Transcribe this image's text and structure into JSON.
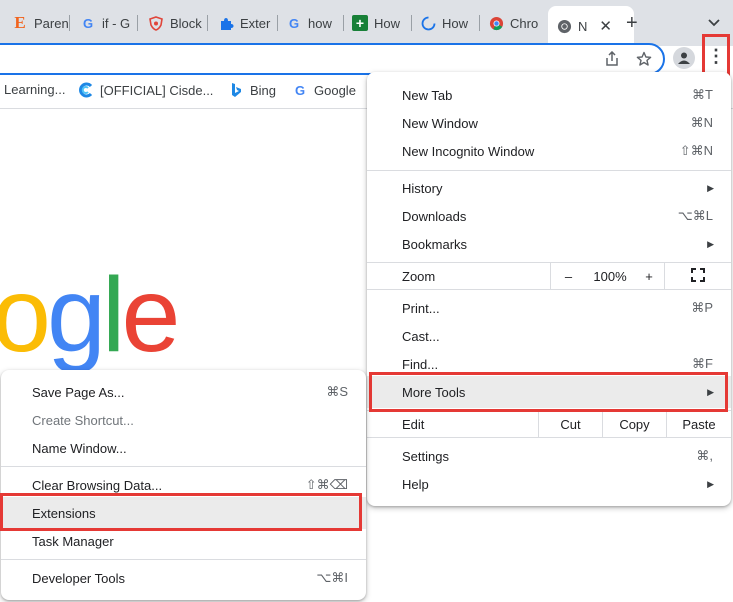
{
  "tabs": [
    {
      "title": "Paren",
      "icon": "etsy-icon"
    },
    {
      "title": "if - G",
      "icon": "google-icon"
    },
    {
      "title": "Block",
      "icon": "shield-icon"
    },
    {
      "title": "Exter",
      "icon": "puzzle-icon"
    },
    {
      "title": "how",
      "icon": "google-icon"
    },
    {
      "title": "How",
      "icon": "plus-icon"
    },
    {
      "title": "How",
      "icon": "loading-icon"
    },
    {
      "title": "Chro",
      "icon": "chrome-icon"
    },
    {
      "title": "N",
      "icon": "chrome-icon"
    }
  ],
  "bookmarks": [
    {
      "label": "Learning...",
      "icon": ""
    },
    {
      "label": "[OFFICIAL] Cisde...",
      "icon": "cisdem-icon"
    },
    {
      "label": "Bing",
      "icon": "bing-icon"
    },
    {
      "label": "Google",
      "icon": "google-icon"
    }
  ],
  "logo_letters": [
    {
      "ch": "o",
      "color": "#fbbc05"
    },
    {
      "ch": "g",
      "color": "#4285f4"
    },
    {
      "ch": "l",
      "color": "#34a853"
    },
    {
      "ch": "e",
      "color": "#ea4335"
    }
  ],
  "main_menu": {
    "new_tab": {
      "label": "New Tab",
      "shortcut": "⌘T"
    },
    "new_window": {
      "label": "New Window",
      "shortcut": "⌘N"
    },
    "new_incognito": {
      "label": "New Incognito Window",
      "shortcut": "⇧⌘N"
    },
    "history": {
      "label": "History"
    },
    "downloads": {
      "label": "Downloads",
      "shortcut": "⌥⌘L"
    },
    "bookmarks": {
      "label": "Bookmarks"
    },
    "zoom": {
      "label": "Zoom",
      "minus": "–",
      "value": "100%",
      "plus": "+"
    },
    "print": {
      "label": "Print...",
      "shortcut": "⌘P"
    },
    "cast": {
      "label": "Cast..."
    },
    "find": {
      "label": "Find...",
      "shortcut": "⌘F"
    },
    "more_tools": {
      "label": "More Tools"
    },
    "edit": {
      "label": "Edit",
      "cut": "Cut",
      "copy": "Copy",
      "paste": "Paste"
    },
    "settings": {
      "label": "Settings",
      "shortcut": "⌘,"
    },
    "help": {
      "label": "Help"
    }
  },
  "sub_menu": {
    "save_page": {
      "label": "Save Page As...",
      "shortcut": "⌘S"
    },
    "create_shortcut": {
      "label": "Create Shortcut..."
    },
    "name_window": {
      "label": "Name Window..."
    },
    "clear_data": {
      "label": "Clear Browsing Data...",
      "shortcut": "⇧⌘⌫"
    },
    "extensions": {
      "label": "Extensions"
    },
    "task_manager": {
      "label": "Task Manager"
    },
    "dev_tools": {
      "label": "Developer Tools",
      "shortcut": "⌥⌘I"
    }
  },
  "colors": {
    "highlight_box": "#e53935",
    "omnibox_border": "#1a73e8",
    "menu_hover": "#ebebeb"
  }
}
